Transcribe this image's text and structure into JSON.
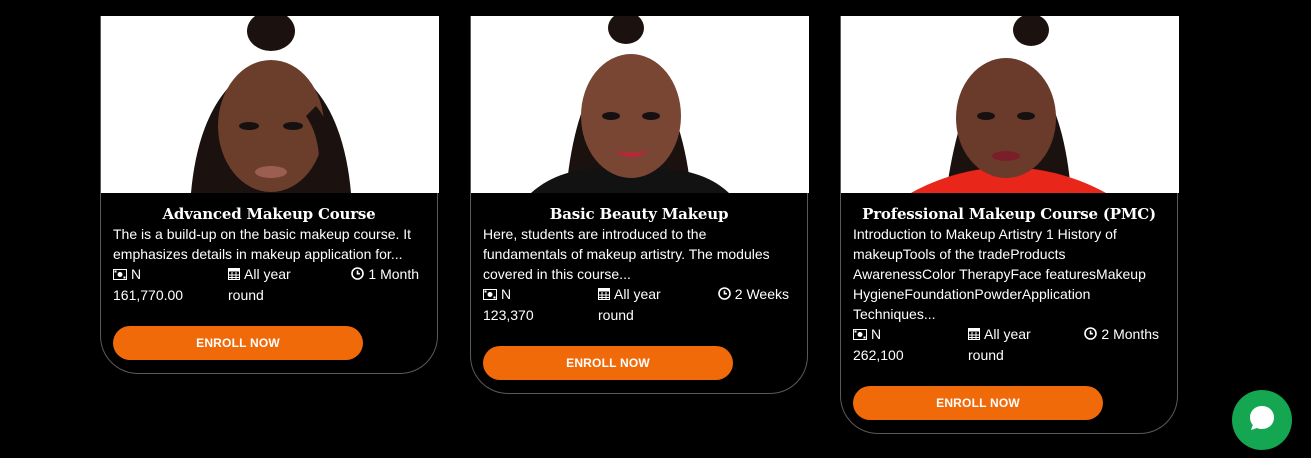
{
  "courses": [
    {
      "title": "Advanced Makeup Course",
      "description_lines": [
        "The is a build-up on the basic makeup course. It",
        "emphasizes details in makeup application for..."
      ],
      "price_lines": [
        "N",
        "161,770.00"
      ],
      "duration_lines": [
        "All year",
        "round"
      ],
      "length": "1 Month",
      "button": "ENROLL NOW",
      "top_color": "#ffffff"
    },
    {
      "title": "Basic Beauty Makeup",
      "description_lines": [
        "Here, students are introduced to the",
        "fundamentals of makeup artistry. The modules",
        "covered in this course..."
      ],
      "price_lines": [
        "N",
        "123,370"
      ],
      "duration_lines": [
        "All year",
        "round"
      ],
      "length": "2 Weeks",
      "button": "ENROLL NOW",
      "top_color": "#111111"
    },
    {
      "title": "Professional Makeup Course (PMC)",
      "description_lines": [
        "Introduction to Makeup Artistry 1 History of",
        "makeupTools of the tradeProducts",
        "AwarenessColor TherapyFace featuresMakeup",
        "HygieneFoundationPowderApplication",
        "Techniques..."
      ],
      "price_lines": [
        "N",
        "262,100"
      ],
      "duration_lines": [
        "All year",
        "round"
      ],
      "length": "2 Months",
      "button": "ENROLL NOW",
      "top_color": "#e8261a"
    }
  ],
  "colors": {
    "accent": "#f06a0a",
    "chat": "#14a651",
    "background": "#000000"
  },
  "icons": {
    "price": "money-icon",
    "duration": "calendar-icon",
    "length": "clock-icon",
    "chat": "chat-bubble-icon"
  }
}
